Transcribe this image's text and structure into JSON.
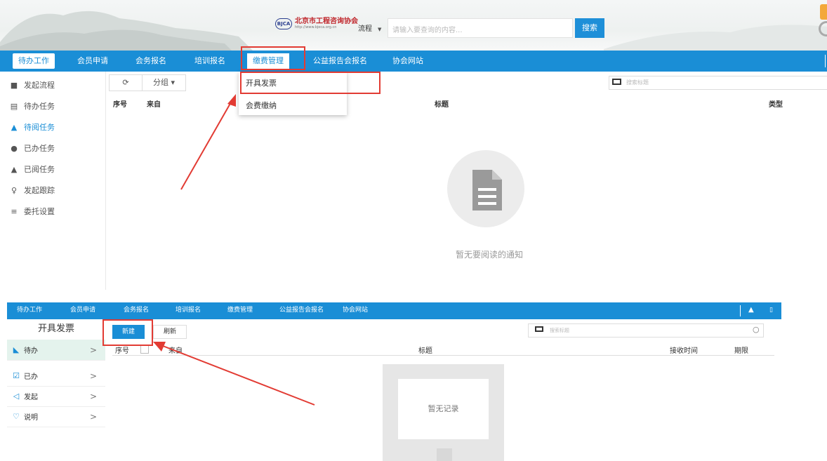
{
  "top": {
    "logo": {
      "name": "北京市工程咨询协会",
      "url": "http://www.bjeca.org.cn",
      "seal": "BJCA"
    },
    "search": {
      "scope": "流程",
      "placeholder": "请输入要查询的内容...",
      "button": "搜索"
    },
    "nav": [
      "待办工作",
      "会员申请",
      "会务报名",
      "培训报名",
      "缴费管理",
      "公益报告会报名",
      "协会网站"
    ],
    "dropdown": [
      "开具发票",
      "会费缴纳"
    ],
    "sidebar": [
      {
        "label": "发起流程",
        "icon": "document-icon"
      },
      {
        "label": "待办任务",
        "icon": "list-icon"
      },
      {
        "label": "待阅任务",
        "icon": "bell-icon"
      },
      {
        "label": "已办任务",
        "icon": "check-circle-icon"
      },
      {
        "label": "已阅任务",
        "icon": "bell-icon"
      },
      {
        "label": "发起跟踪",
        "icon": "person-pin-icon"
      },
      {
        "label": "委托设置",
        "icon": "handshake-icon"
      }
    ],
    "toolbar": {
      "group": "分组"
    },
    "search_title_placeholder": "搜索标题",
    "columns": [
      "序号",
      "来自",
      "标题",
      "类型"
    ],
    "empty_text": "暂无要阅读的通知"
  },
  "bottom": {
    "nav": [
      "待办工作",
      "会员申请",
      "会务报名",
      "培训报名",
      "缴费管理",
      "公益报告会报名",
      "协会网站"
    ],
    "sidebar_title": "开具发票",
    "sidebar": [
      {
        "label": "待办",
        "icon": "inbox-icon"
      },
      {
        "label": "已办",
        "icon": "checklist-icon"
      },
      {
        "label": "发起",
        "icon": "send-icon"
      },
      {
        "label": "说明",
        "icon": "lightbulb-icon"
      }
    ],
    "new_button": "新建",
    "refresh_button": "刷新",
    "search_title_placeholder": "搜索标题",
    "columns": [
      "序号",
      "来自",
      "标题",
      "接收时间",
      "期限"
    ],
    "empty_text": "暂无记录"
  },
  "colors": {
    "primary": "#1a8ed6",
    "annotation": "#e23b33"
  }
}
